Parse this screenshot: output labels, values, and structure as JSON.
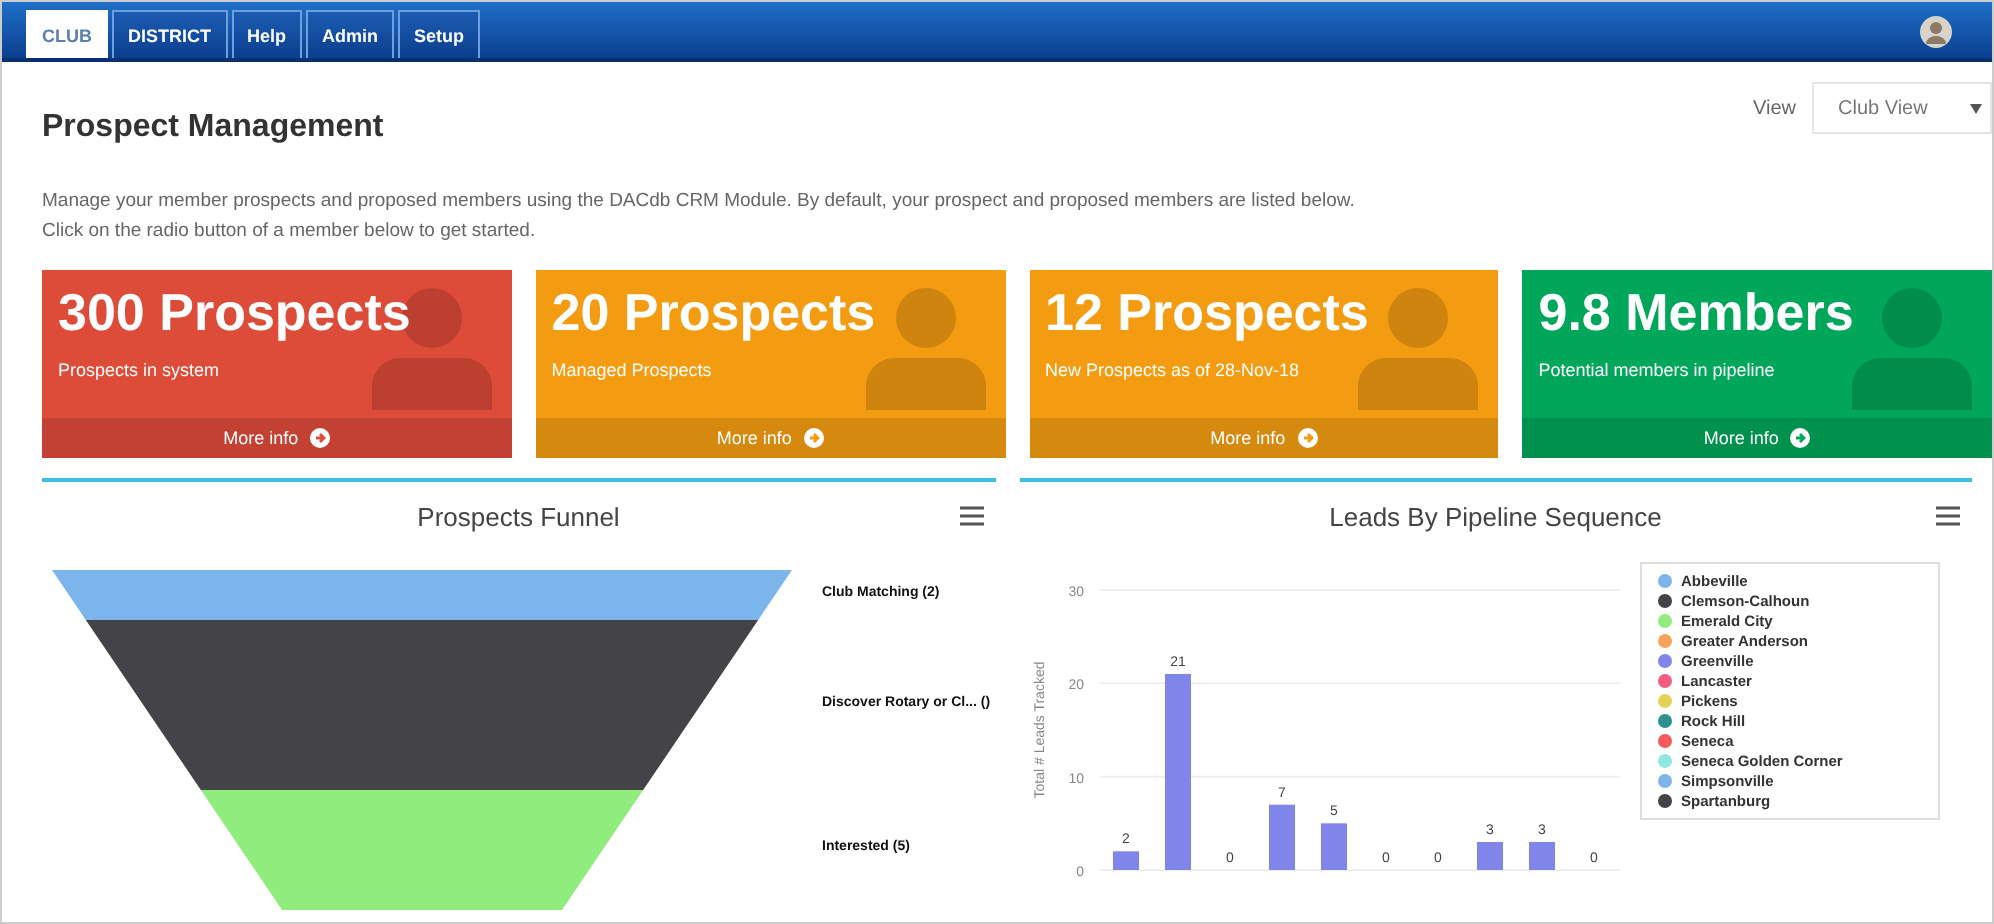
{
  "nav": {
    "tabs": [
      {
        "label": "CLUB",
        "selected": true
      },
      {
        "label": "DISTRICT",
        "selected": false
      },
      {
        "label": "Help",
        "selected": false
      },
      {
        "label": "Admin",
        "selected": false
      },
      {
        "label": "Setup",
        "selected": false
      }
    ]
  },
  "header": {
    "title": "Prospect Management",
    "view_label": "View",
    "view_value": "Club View",
    "description": "Manage your member prospects and proposed members using the DACdb CRM Module. By default, your prospect and proposed members are listed below. Click on the radio button of a member below to get started."
  },
  "cards": [
    {
      "value": "300 Prospects",
      "caption": "Prospects in system",
      "link": "More info",
      "color": "#dd4b39"
    },
    {
      "value": "20 Prospects",
      "caption": "Managed Prospects",
      "link": "More info",
      "color": "#f39c12"
    },
    {
      "value": "12 Prospects",
      "caption": "New Prospects as of 28-Nov-18",
      "link": "More info",
      "color": "#f39c12"
    },
    {
      "value": "9.8 Members",
      "caption": "Potential members in pipeline",
      "link": "More info",
      "color": "#00a65a"
    }
  ],
  "funnel": {
    "title": "Prospects Funnel",
    "stages": [
      {
        "label": "Club Matching (2)",
        "color": "#7cb5ec"
      },
      {
        "label": "Discover Rotary or Cl... ()",
        "color": "#434348"
      },
      {
        "label": "Interested (5)",
        "color": "#90ed7d"
      }
    ]
  },
  "pipeline": {
    "title": "Leads By Pipeline Sequence",
    "chart_data": {
      "type": "bar",
      "ylabel": "Total # Leads Tracked",
      "values": [
        2,
        21,
        0,
        7,
        5,
        0,
        0,
        3,
        3,
        0
      ],
      "ylim": [
        0,
        30
      ],
      "yticks": [
        0,
        10,
        20,
        30
      ],
      "data_labels": true
    },
    "legend": [
      {
        "label": "Abbeville",
        "color": "#7cb5ec"
      },
      {
        "label": "Clemson-Calhoun",
        "color": "#434348"
      },
      {
        "label": "Emerald City",
        "color": "#90ed7d"
      },
      {
        "label": "Greater Anderson",
        "color": "#f7a35c"
      },
      {
        "label": "Greenville",
        "color": "#8085e9"
      },
      {
        "label": "Lancaster",
        "color": "#f15c80"
      },
      {
        "label": "Pickens",
        "color": "#e4d354"
      },
      {
        "label": "Rock Hill",
        "color": "#2b908f"
      },
      {
        "label": "Seneca",
        "color": "#f45b5b"
      },
      {
        "label": "Seneca Golden Corner",
        "color": "#91e8e1"
      },
      {
        "label": "Simpsonville",
        "color": "#7cb5ec"
      },
      {
        "label": "Spartanburg",
        "color": "#434348"
      }
    ]
  }
}
